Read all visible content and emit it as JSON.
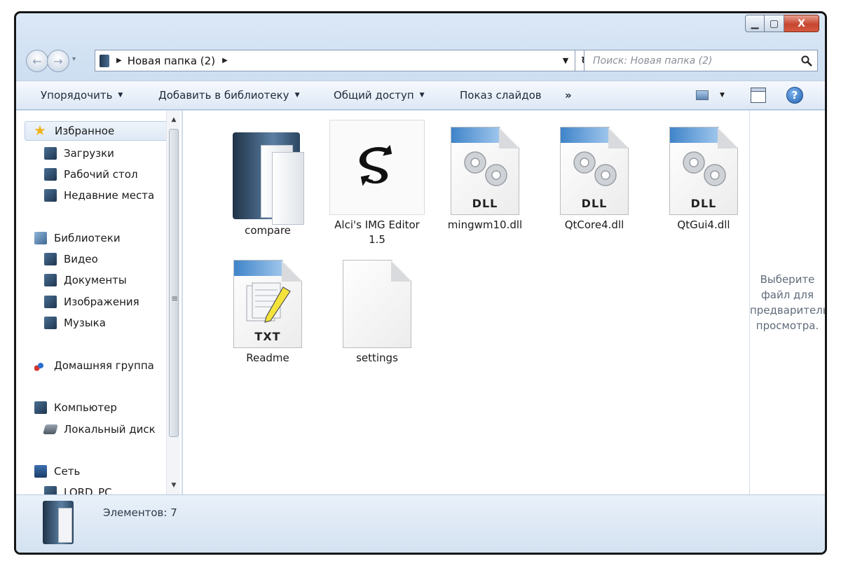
{
  "window": {
    "caption": {
      "minimize": "▁",
      "maximize": "▢",
      "close": "X"
    }
  },
  "nav": {
    "path": "Новая папка (2)",
    "search_placeholder": "Поиск: Новая папка (2)"
  },
  "toolbar": {
    "organize": "Упорядочить",
    "add_to_library": "Добавить в библиотеку",
    "share": "Общий доступ",
    "slideshow": "Показ слайдов",
    "more": "»",
    "help": "?"
  },
  "sidebar": {
    "favorites": "Избранное",
    "downloads": "Загрузки",
    "desktop": "Рабочий стол",
    "recent": "Недавние места",
    "libraries": "Библиотеки",
    "video": "Видео",
    "documents": "Документы",
    "images": "Изображения",
    "music": "Музыка",
    "homegroup": "Домашняя группа",
    "computer": "Компьютер",
    "local_disk": "Локальный диск",
    "network": "Сеть",
    "network_pc": "LORD_PC"
  },
  "files": [
    {
      "name": "compare",
      "type": "folder"
    },
    {
      "name": "Alci's IMG Editor 1.5",
      "type": "exe"
    },
    {
      "name": "mingwm10.dll",
      "type": "dll",
      "ext": "DLL"
    },
    {
      "name": "QtCore4.dll",
      "type": "dll",
      "ext": "DLL"
    },
    {
      "name": "QtGui4.dll",
      "type": "dll",
      "ext": "DLL"
    },
    {
      "name": "Readme",
      "type": "txt",
      "ext": "TXT"
    },
    {
      "name": "settings",
      "type": "file"
    }
  ],
  "preview": {
    "message": "Выберите\nфайл для\nпредварительного\nпросмотра."
  },
  "status": {
    "items": "Элементов: 7"
  },
  "colors": {
    "frame": "#c9dcf0",
    "selection": "#dfe9f5",
    "close_button": "#c6452f"
  }
}
